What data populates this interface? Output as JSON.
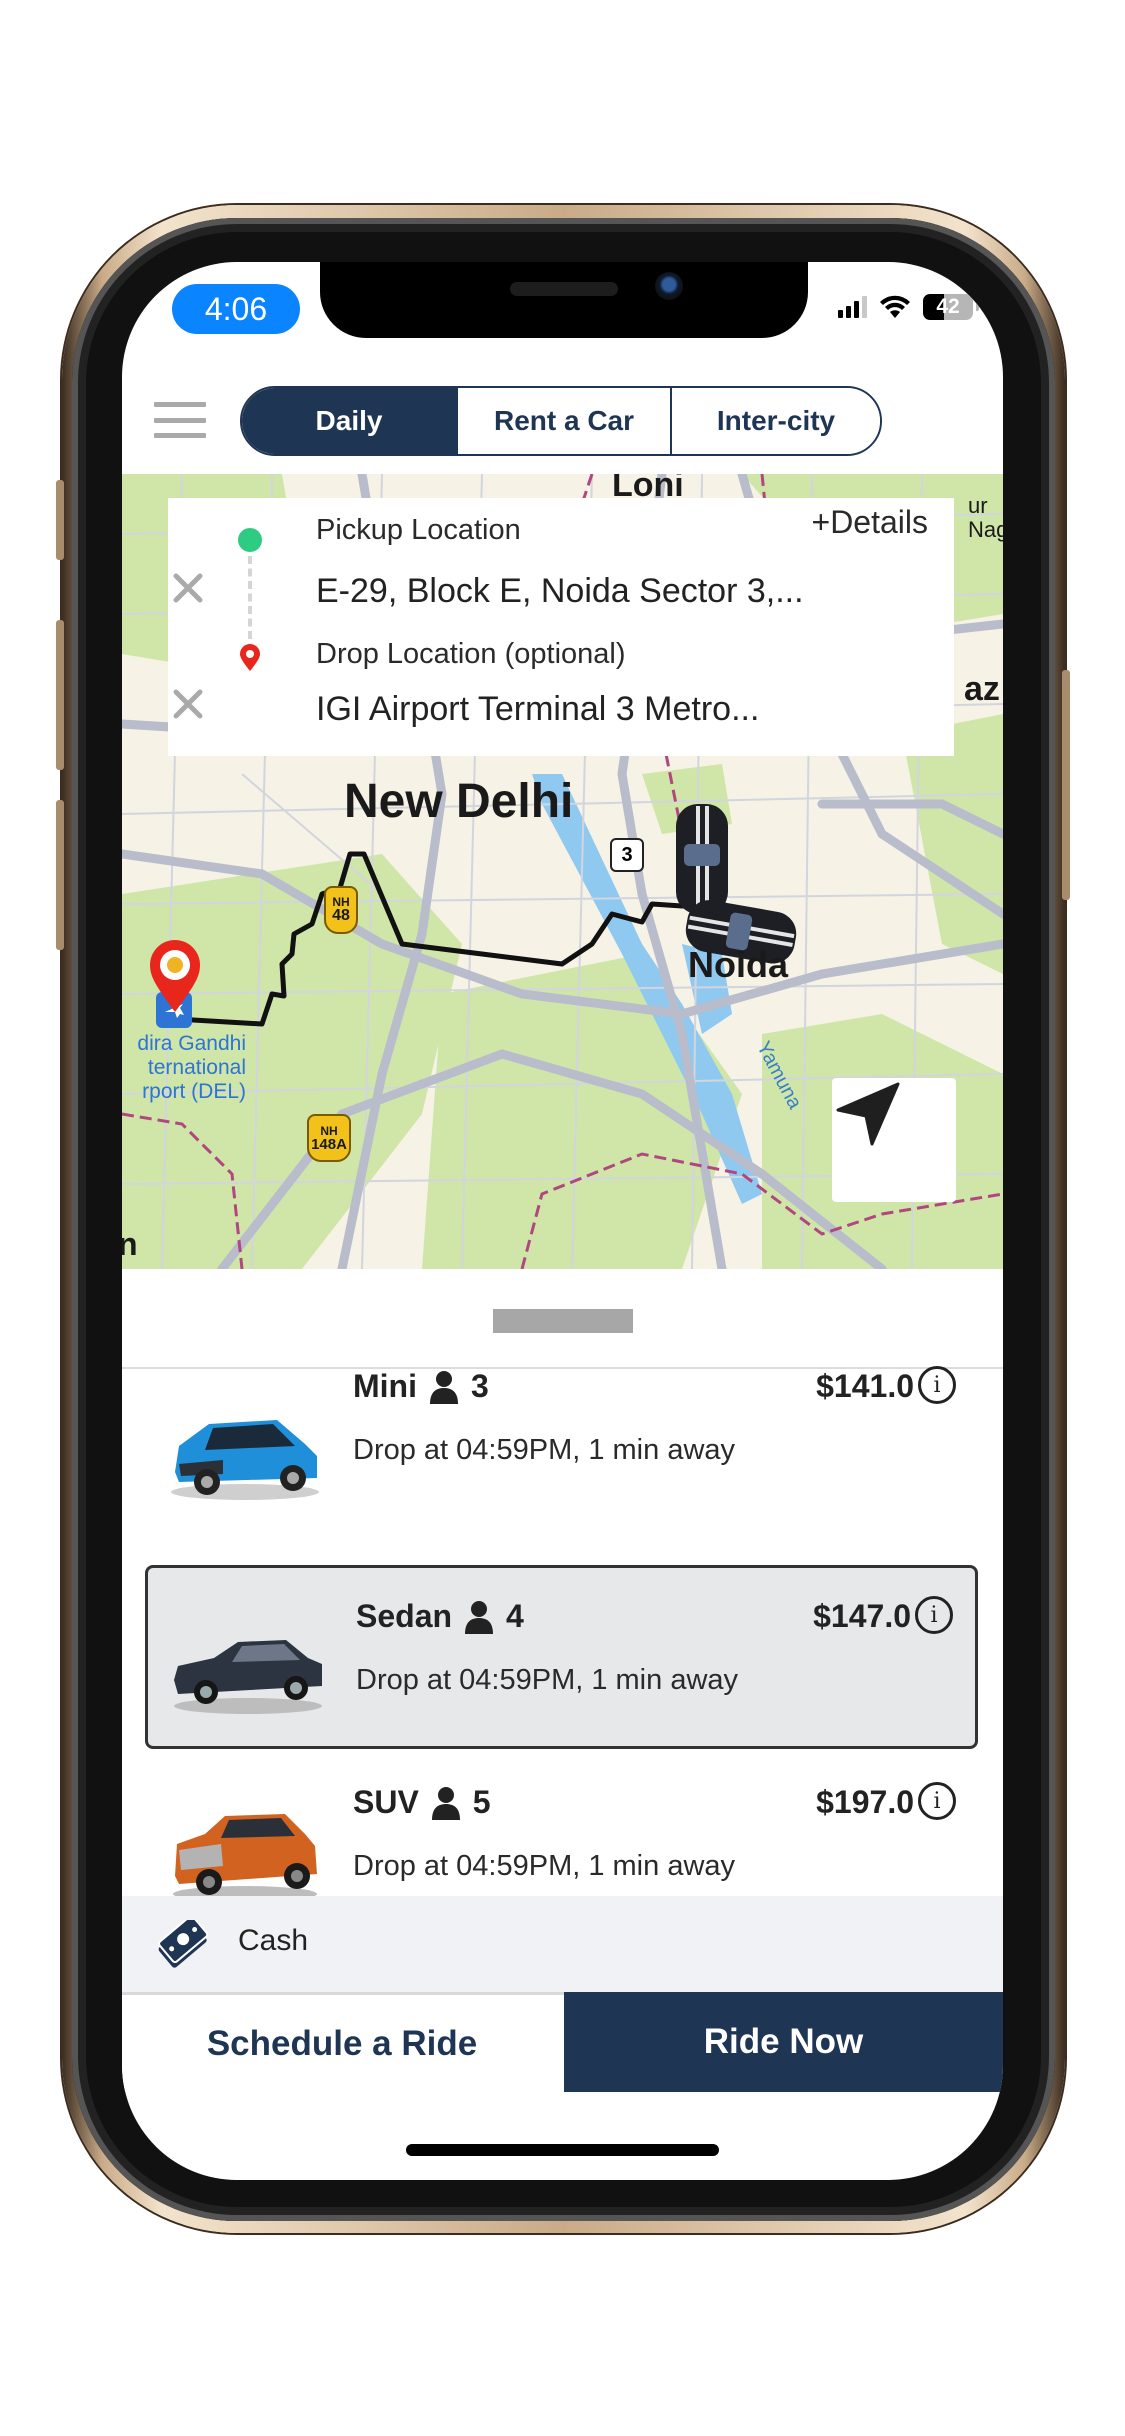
{
  "status_bar": {
    "time": "4:06",
    "battery_level": "42",
    "signal_icon": "cellular-signal-icon",
    "wifi_icon": "wifi-icon"
  },
  "header": {
    "menu_icon": "hamburger-menu-icon",
    "tabs": [
      {
        "label": "Daily",
        "active": true
      },
      {
        "label": "Rent a Car",
        "active": false
      },
      {
        "label": "Inter-city",
        "active": false
      }
    ]
  },
  "locations": {
    "details_link": "+Details",
    "pickup": {
      "label": "Pickup Location",
      "value": "E-29, Block E, Noida Sector 3,..."
    },
    "drop": {
      "label": "Drop Location (optional)",
      "value": "IGI Airport Terminal 3 Metro..."
    }
  },
  "map": {
    "labels": {
      "loni": "Loni",
      "new_delhi": "New Delhi",
      "noida": "Noida",
      "yamuna": "Yamuna",
      "airport": "dira Gandhi\nternational\nrport (DEL)",
      "edge_right_top": "ur\nNag",
      "edge_right_mid": "az",
      "edge_left_bottom": "n"
    },
    "shields": {
      "nh48_top": "NH",
      "nh48_bottom": "48",
      "nh148a_top": "NH",
      "nh148a_bottom": "148A",
      "route3": "3"
    },
    "colors": {
      "land": "#f6f2e6",
      "park": "#cfe6a8",
      "road": "#b9bccb",
      "water": "#8fc9f0",
      "route": "#111111",
      "boundary": "#b0477f"
    }
  },
  "ride_options": [
    {
      "name": "Mini",
      "seats": "3",
      "price": "$141.0",
      "eta": "Drop at 04:59PM, 1 min away",
      "car_color": "#1e8fd8",
      "selected": false
    },
    {
      "name": "Sedan",
      "seats": "4",
      "price": "$147.0",
      "eta": "Drop at 04:59PM, 1 min away",
      "car_color": "#2b3440",
      "selected": true
    },
    {
      "name": "SUV",
      "seats": "5",
      "price": "$197.0",
      "eta": "Drop at 04:59PM, 1 min away",
      "car_color": "#d2621f",
      "selected": false
    }
  ],
  "payment": {
    "method": "Cash"
  },
  "actions": {
    "schedule": "Schedule a Ride",
    "ride_now": "Ride Now"
  },
  "colors": {
    "brand_navy": "#1f3554",
    "pickup_green": "#2ecc83",
    "drop_red": "#e8261c",
    "status_blue": "#0a84ff"
  }
}
